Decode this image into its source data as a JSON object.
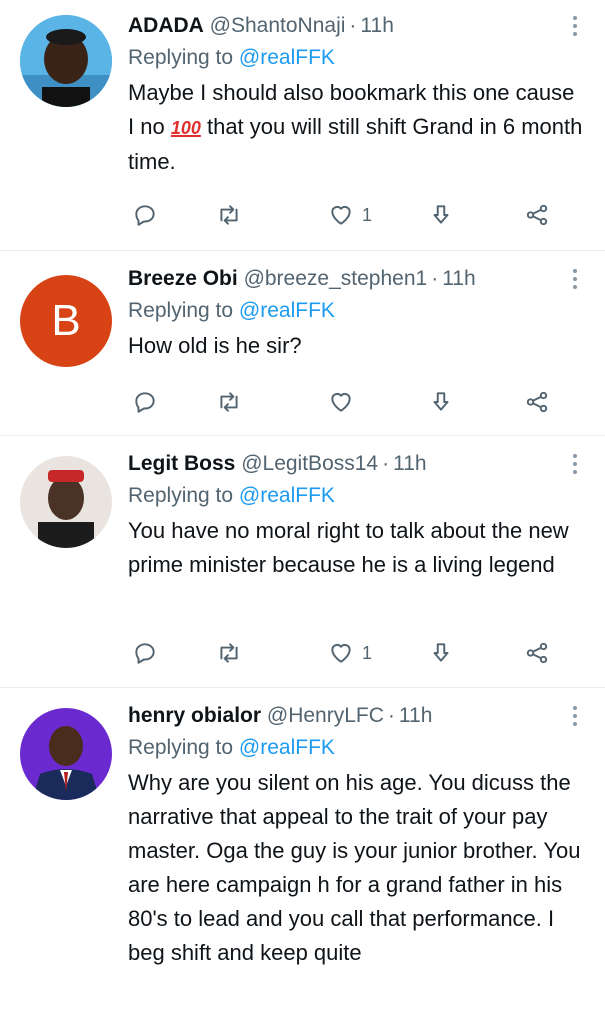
{
  "colors": {
    "link": "#1d9bf0",
    "muted": "#536471",
    "divider": "#e6ecf0",
    "avatar_b_bg": "#d84315"
  },
  "tweets": [
    {
      "name": "ADADA",
      "handle": "@ShantoNnaji",
      "time": "11h",
      "replying_prefix": "Replying to",
      "replying_to": "@realFFK",
      "text_before_emoji": "Maybe I should also bookmark this one cause I no ",
      "emoji": "100",
      "text_after_emoji": " that you will still shift Grand in 6 month time.",
      "like_count": "1"
    },
    {
      "name": "Breeze Obi",
      "handle": "@breeze_stephen1",
      "time": "11h",
      "avatar_letter": "B",
      "replying_prefix": "Replying to",
      "replying_to": "@realFFK",
      "text": "How old is he sir?",
      "like_count": ""
    },
    {
      "name": "Legit Boss",
      "handle": "@LegitBoss14",
      "time": "11h",
      "replying_prefix": "Replying to",
      "replying_to": "@realFFK",
      "text": "You have no moral right to talk about the new prime minister because he is a living legend",
      "like_count": "1"
    },
    {
      "name": "henry obialor",
      "handle": "@HenryLFC",
      "time": "11h",
      "replying_prefix": "Replying to",
      "replying_to": "@realFFK",
      "text": "Why are you silent on his age. You dicuss the narrative that appeal to the trait of your pay master. Oga the guy is your junior brother. You are here campaign h for a grand father in his 80's to lead and you call that performance. I beg shift and keep quite"
    }
  ],
  "separator": "·"
}
